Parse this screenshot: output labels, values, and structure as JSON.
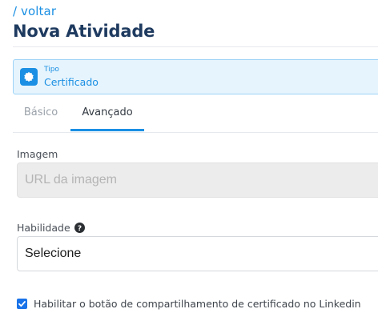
{
  "header": {
    "back_link": "/ voltar",
    "title": "Nova Atividade"
  },
  "type_card": {
    "label": "Tipo",
    "value": "Certificado",
    "icon": "certificate-badge-icon",
    "accent_color": "#1a8fe3"
  },
  "tabs": [
    {
      "label": "Básico",
      "active": false
    },
    {
      "label": "Avançado",
      "active": true
    }
  ],
  "form": {
    "image": {
      "label": "Imagem",
      "placeholder": "URL da imagem",
      "value": ""
    },
    "skill": {
      "label": "Habilidade",
      "help_icon": "question-circle-icon",
      "selected": "Selecione"
    },
    "share_certificate": {
      "label": "Habilitar o botão de compartilhamento de certificado no Linkedin",
      "checked": true
    }
  }
}
